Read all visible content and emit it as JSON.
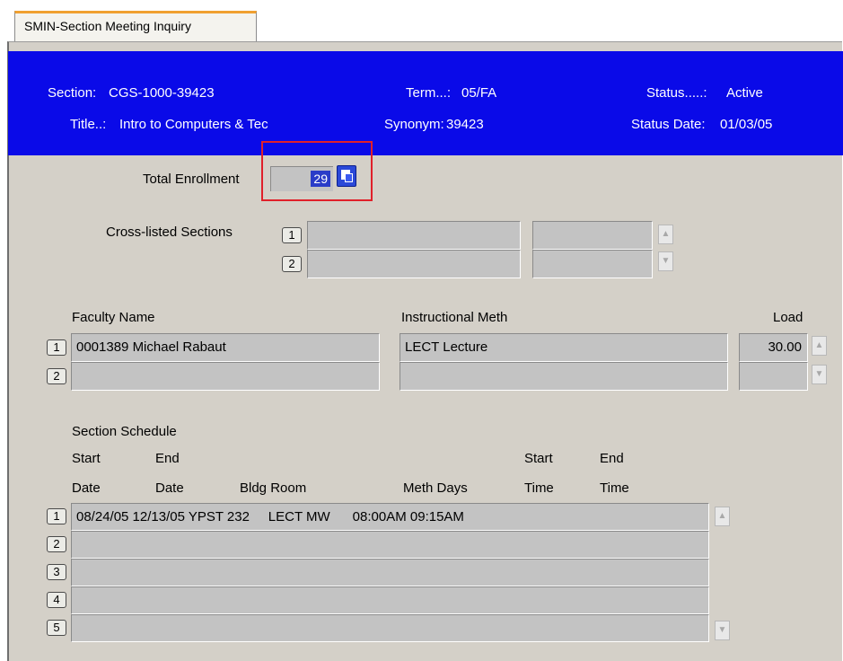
{
  "tab": {
    "label": "SMIN-Section Meeting Inquiry"
  },
  "header": {
    "section_label": "Section:",
    "section_value": "CGS-1000-39423",
    "title_label": "Title..:",
    "title_value": "Intro to Computers & Tec",
    "term_label": "Term...:",
    "term_value": "05/FA",
    "synonym_label": "Synonym:",
    "synonym_value": "39423",
    "status_label": "Status.....:",
    "status_value": "Active",
    "status_date_label": "Status Date:",
    "status_date_value": "01/03/05"
  },
  "enrollment": {
    "label": "Total Enrollment",
    "value": "29"
  },
  "cross_listed": {
    "label": "Cross-listed Sections",
    "rows": [
      {
        "num": "1"
      },
      {
        "num": "2"
      }
    ]
  },
  "faculty": {
    "headers": {
      "name": "Faculty Name",
      "method": "Instructional Meth",
      "load": "Load"
    },
    "rows": [
      {
        "num": "1",
        "name": "0001389 Michael Rabaut",
        "method": "LECT  Lecture",
        "load": "30.00"
      },
      {
        "num": "2",
        "name": "",
        "method": "",
        "load": ""
      }
    ]
  },
  "schedule": {
    "title": "Section Schedule",
    "headers": {
      "start_top": "Start",
      "end_top": "End",
      "start_date": "Date",
      "end_date": "Date",
      "bldg_room": "Bldg Room",
      "meth_days": "Meth Days",
      "start_time_top": "Start",
      "end_time_top": "End",
      "start_time": "Time",
      "end_time": "Time"
    },
    "rows": [
      {
        "num": "1",
        "text": "08/24/05 12/13/05 YPST 232     LECT MW      08:00AM 09:15AM"
      },
      {
        "num": "2",
        "text": ""
      },
      {
        "num": "3",
        "text": ""
      },
      {
        "num": "4",
        "text": ""
      },
      {
        "num": "5",
        "text": ""
      }
    ]
  },
  "colors": {
    "header_bg": "#0a0ae8",
    "highlight": "#e0202a",
    "panel_bg": "#d4d0c8"
  },
  "icons": {
    "detail": "detail-window-icon",
    "scroll_up": "scroll-up-icon",
    "scroll_down": "scroll-down-icon"
  }
}
